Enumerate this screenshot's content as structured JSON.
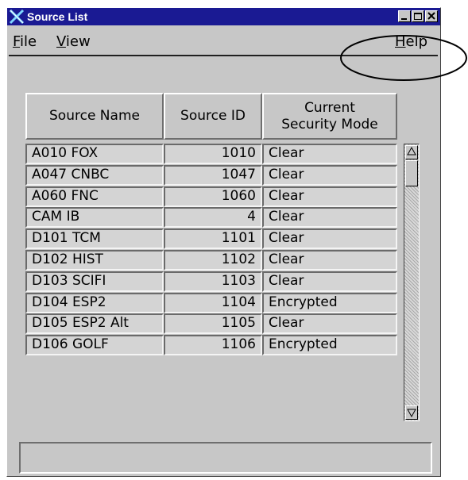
{
  "window": {
    "title": "Source List",
    "icon": "x-app-icon"
  },
  "menubar": {
    "file": {
      "mnemonic": "F",
      "rest": "ile"
    },
    "view": {
      "mnemonic": "V",
      "rest": "iew"
    },
    "help": {
      "mnemonic": "H",
      "rest": "elp"
    }
  },
  "table": {
    "headers": {
      "name": "Source Name",
      "id": "Source ID",
      "mode_line1": "Current",
      "mode_line2": "Security Mode"
    },
    "rows": [
      {
        "name": "A010 FOX",
        "id": "1010",
        "mode": "Clear"
      },
      {
        "name": "A047 CNBC",
        "id": "1047",
        "mode": "Clear"
      },
      {
        "name": "A060 FNC",
        "id": "1060",
        "mode": "Clear"
      },
      {
        "name": "CAM IB",
        "id": "4",
        "mode": "Clear"
      },
      {
        "name": "D101 TCM",
        "id": "1101",
        "mode": "Clear"
      },
      {
        "name": "D102 HIST",
        "id": "1102",
        "mode": "Clear"
      },
      {
        "name": "D103 SCIFI",
        "id": "1103",
        "mode": "Clear"
      },
      {
        "name": "D104 ESP2",
        "id": "1104",
        "mode": "Encrypted"
      },
      {
        "name": "D105 ESP2 Alt",
        "id": "1105",
        "mode": "Clear"
      },
      {
        "name": "D106 GOLF",
        "id": "1106",
        "mode": "Encrypted"
      }
    ]
  },
  "status": {
    "text": ""
  },
  "colors": {
    "titlebar": "#1a1a93",
    "window_bg": "#c7c7c7",
    "cell_bg": "#d4d4d4"
  }
}
